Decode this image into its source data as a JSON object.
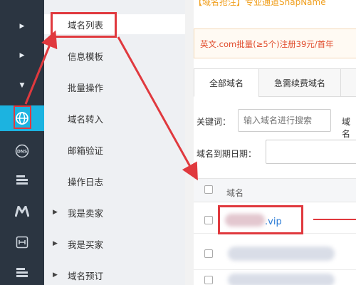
{
  "header": {
    "top_banner": "【域名抢注】专业通道SnapName"
  },
  "sidebar_icons": [
    {
      "icon": "chevron-right-icon",
      "glyph": "▶"
    },
    {
      "icon": "chevron-right-icon",
      "glyph": "▶"
    },
    {
      "icon": "chevron-down-icon",
      "glyph": "▼"
    },
    {
      "icon": "globe-icon",
      "glyph": "🌐"
    },
    {
      "icon": "dns-icon",
      "glyph": "DNS"
    },
    {
      "icon": "server-icon",
      "glyph": "▤"
    },
    {
      "icon": "m-logo-icon",
      "glyph": "M"
    },
    {
      "icon": "gateway-icon",
      "glyph": "⊟"
    },
    {
      "icon": "server-icon",
      "glyph": "▤"
    }
  ],
  "submenu": {
    "items": [
      {
        "label": "域名列表",
        "has_arrow": false
      },
      {
        "label": "信息模板",
        "has_arrow": false
      },
      {
        "label": "批量操作",
        "has_arrow": false
      },
      {
        "label": "域名转入",
        "has_arrow": false
      },
      {
        "label": "邮箱验证",
        "has_arrow": false
      },
      {
        "label": "操作日志",
        "has_arrow": false
      },
      {
        "label": "我是卖家",
        "has_arrow": true
      },
      {
        "label": "我是买家",
        "has_arrow": true
      },
      {
        "label": "域名预订",
        "has_arrow": true
      }
    ]
  },
  "promo": {
    "text": "英文.com批量(≥5个)注册39元/首年"
  },
  "tabs": [
    {
      "label": "全部域名"
    },
    {
      "label": "急需续费域名"
    }
  ],
  "filters": {
    "keyword_label": "关键词：",
    "keyword_placeholder": "输入域名进行搜索",
    "keyword_label2": "域名",
    "expiry_label": "域名到期日期："
  },
  "table": {
    "header": "域名",
    "rows": [
      {
        "domain_suffix": ".vip"
      }
    ]
  },
  "colors": {
    "accent": "#1cb3e0",
    "annotation": "#e0393e",
    "rail": "#2b3541"
  }
}
